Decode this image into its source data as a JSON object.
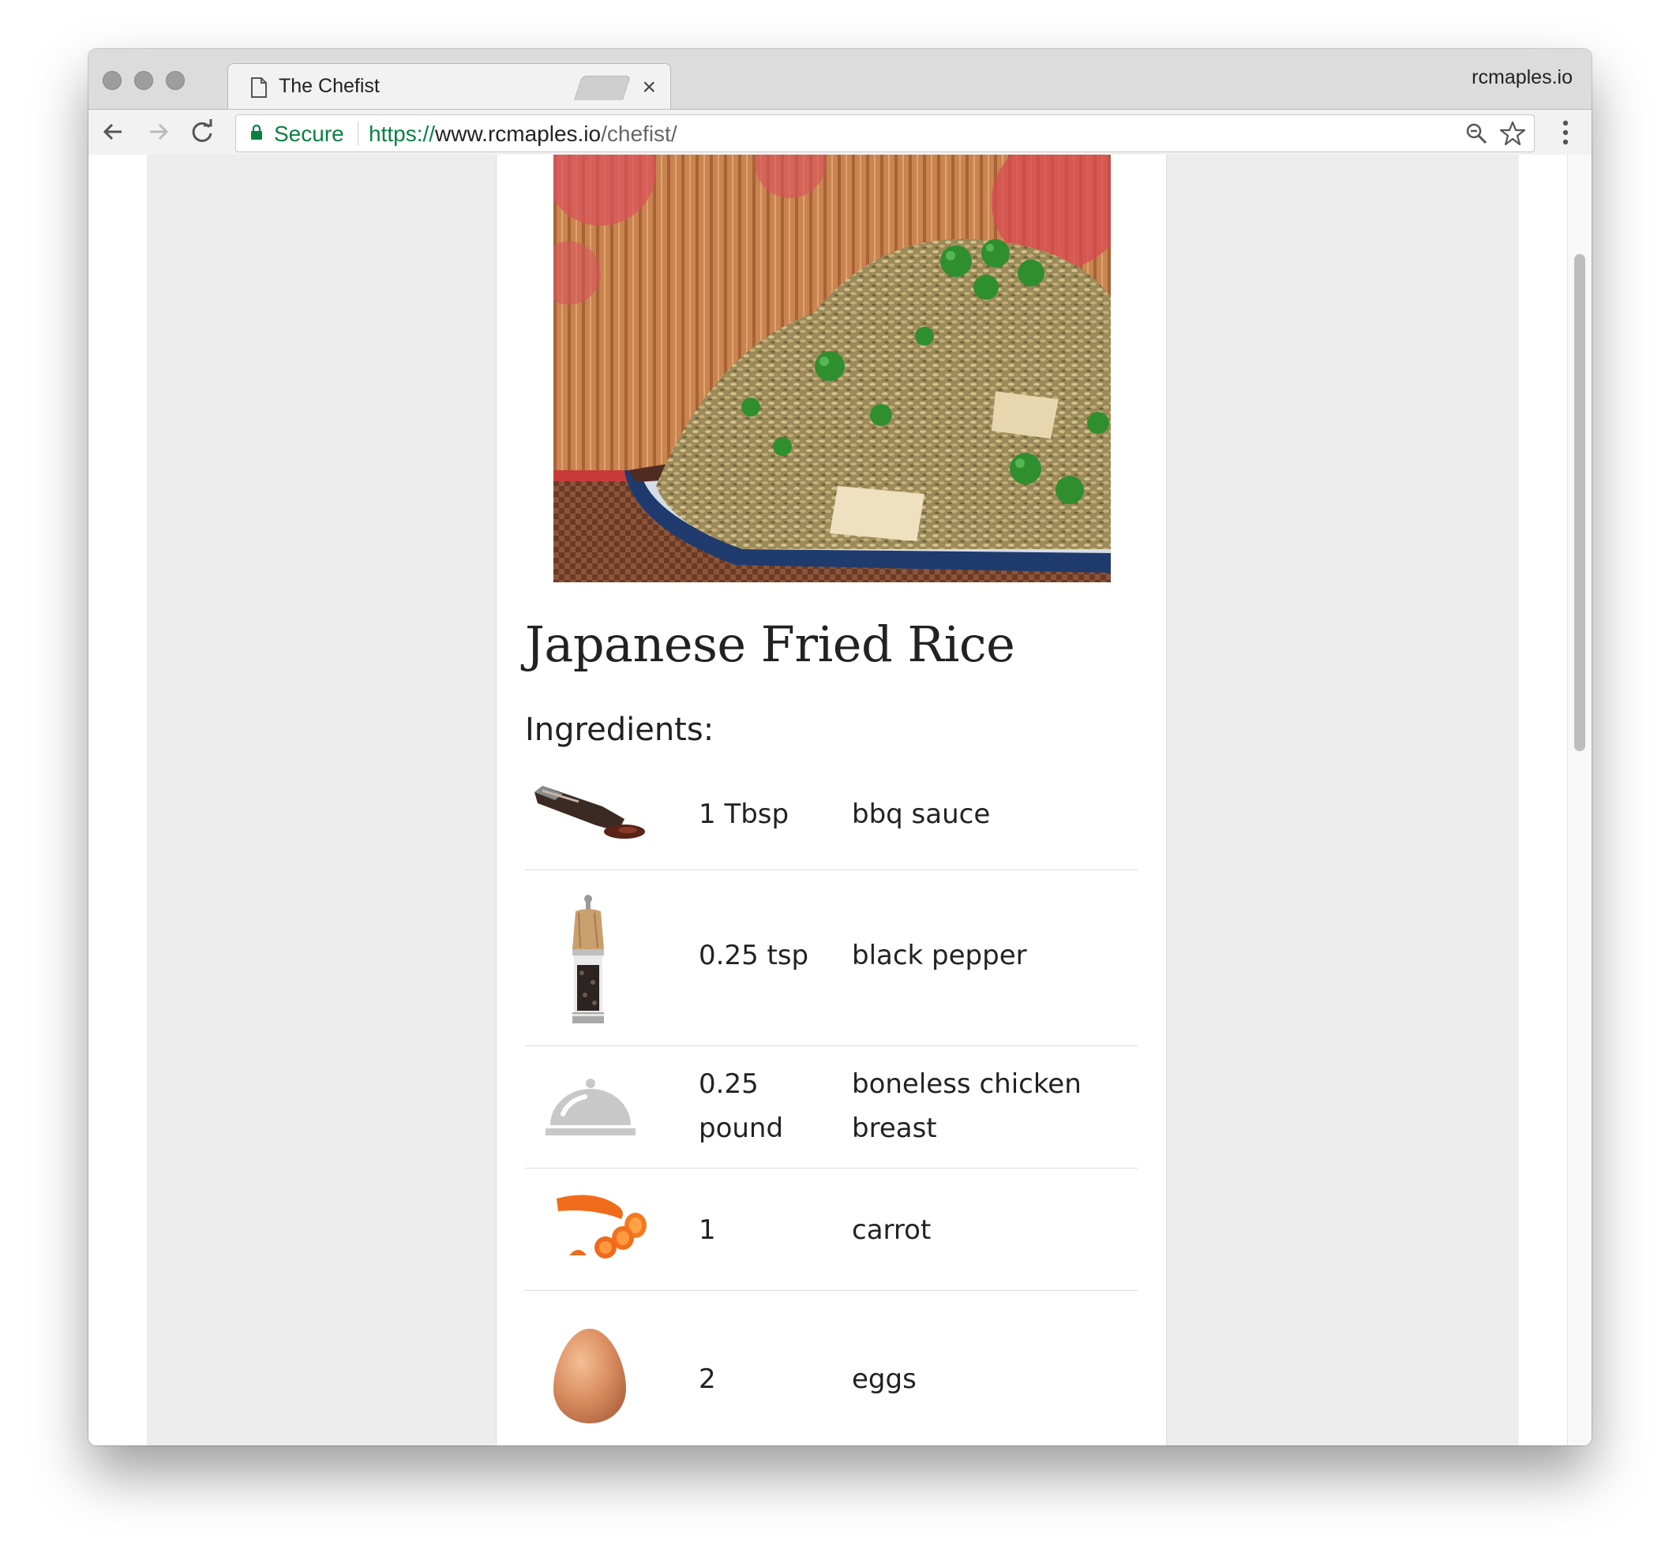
{
  "browser": {
    "tab_title": "The Chefist",
    "tab_close": "×",
    "profile": "rcmaples.io",
    "secure_label": "Secure",
    "url_scheme": "https://",
    "url_host": "www.rcmaples.io",
    "url_path": "/chefist/"
  },
  "recipe": {
    "title": "Japanese Fried Rice",
    "ingredients_heading": "Ingredients:",
    "ingredients": [
      {
        "qty": "1 Tbsp",
        "name": "bbq sauce",
        "icon": "bbq-sauce-icon"
      },
      {
        "qty": "0.25 tsp",
        "name": "black pepper",
        "icon": "pepper-grinder-icon"
      },
      {
        "qty": "0.25 pound",
        "name": "boneless chicken breast",
        "icon": "cloche-icon"
      },
      {
        "qty": "1",
        "name": "carrot",
        "icon": "carrot-icon"
      },
      {
        "qty": "2",
        "name": "eggs",
        "icon": "egg-icon"
      }
    ]
  },
  "colors": {
    "secure_green": "#0b8043",
    "page_background": "#ededed",
    "card_background": "#ffffff"
  }
}
